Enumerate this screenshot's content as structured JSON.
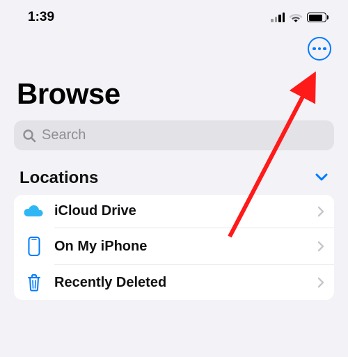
{
  "status_bar": {
    "time": "1:39"
  },
  "page": {
    "title": "Browse",
    "search_placeholder": "Search"
  },
  "locations": {
    "header": "Locations",
    "items": [
      {
        "label": "iCloud Drive",
        "icon": "cloud"
      },
      {
        "label": "On My iPhone",
        "icon": "iphone"
      },
      {
        "label": "Recently Deleted",
        "icon": "trash"
      }
    ]
  },
  "colors": {
    "accent": "#007aff",
    "destructive_trash": "#0a84ff"
  }
}
